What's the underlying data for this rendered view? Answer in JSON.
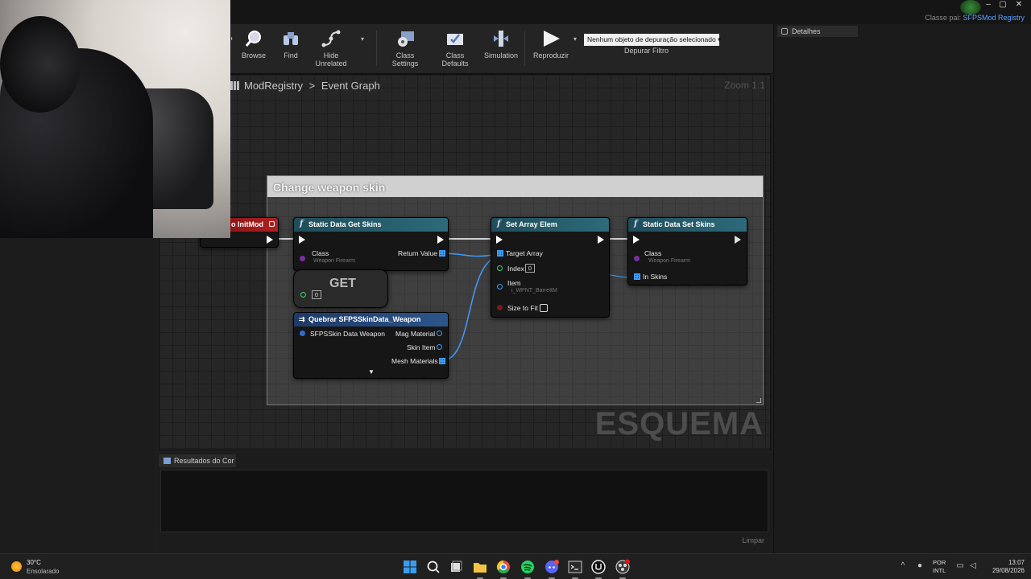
{
  "window": {
    "classe_prefix": "Classe pai:",
    "classe_value": "SFPSMod Registry",
    "min": "–",
    "max": "▢",
    "close": "✕"
  },
  "toolbar": {
    "browse": "Browse",
    "find": "Find",
    "hide_unrelated": "Hide Unrelated",
    "class_settings": "Class Settings",
    "class_defaults": "Class Defaults",
    "simulation": "Simulation",
    "play": "Reproduzir",
    "debug_select": "Nenhum objeto de depuração selecionado",
    "debug_filter": "Depurar Filtro"
  },
  "details": {
    "tab": "Detalhes"
  },
  "graph": {
    "breadcrumb_root": "ModRegistry",
    "breadcrumb_sep": ">",
    "breadcrumb_leaf": "Event Graph",
    "zoom": "Zoom 1:1",
    "watermark": "ESQUEMA",
    "comment": "Change weapon skin",
    "nodes": {
      "initmod": {
        "title": "o InitMod"
      },
      "get_skins": {
        "title": "Static Data Get Skins",
        "pin_class": "Class",
        "pin_class_value": "Weapon Firearm",
        "pin_return": "Return Value"
      },
      "get": {
        "title": "GET",
        "index": "0"
      },
      "quebrar": {
        "title": "Quebrar SFPSSkinData_Weapon",
        "pin_in": "SFPSSkin Data Weapon",
        "pin_mag": "Mag Material",
        "pin_skin": "Skin Item",
        "pin_mesh": "Mesh Materials",
        "expand": "▼"
      },
      "set_array": {
        "title": "Set Array Elem",
        "pin_target": "Target Array",
        "pin_index": "Index",
        "index_value": "0",
        "pin_item": "Item",
        "item_value": "i_WPNT_BarrettM",
        "pin_size": "Size to Fit"
      },
      "set_skins": {
        "title": "Static Data Set Skins",
        "pin_class": "Class",
        "pin_class_value": "Weapon Firearm",
        "pin_skins": "In Skins"
      }
    }
  },
  "results": {
    "tab": "Resultados do Cor",
    "clear": "Limpar"
  },
  "taskbar": {
    "temp": "30°C",
    "condition": "Ensolarado",
    "lang_1": "POR",
    "lang_2": "INTL",
    "time": "13:07",
    "date": "29/08/2026",
    "colors": {
      "start": "#3a9cf0",
      "files": "#f4c342",
      "chrome": "#e84a3c",
      "spotify": "#1ed760",
      "discord": "#5865f2"
    }
  }
}
